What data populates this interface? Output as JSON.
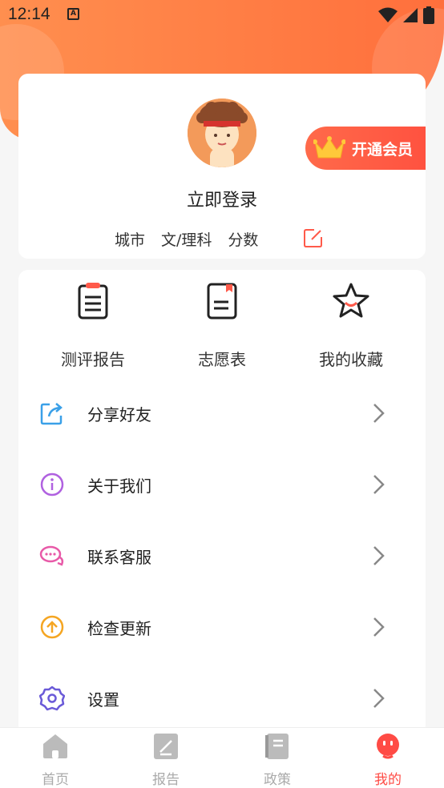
{
  "status_bar": {
    "time": "12:14",
    "app_icon_letter": "A"
  },
  "profile": {
    "login_label": "立即登录",
    "meta": [
      "城市",
      "文/理科",
      "分数"
    ],
    "vip_label": "开通会员"
  },
  "shortcuts": [
    {
      "label": "测评报告",
      "icon": "report-icon"
    },
    {
      "label": "志愿表",
      "icon": "form-icon"
    },
    {
      "label": "我的收藏",
      "icon": "star-icon"
    }
  ],
  "menu": [
    {
      "label": "分享好友",
      "icon": "share-icon"
    },
    {
      "label": "关于我们",
      "icon": "info-icon"
    },
    {
      "label": "联系客服",
      "icon": "chat-icon"
    },
    {
      "label": "检查更新",
      "icon": "update-icon"
    },
    {
      "label": "设置",
      "icon": "gear-icon"
    }
  ],
  "tabbar": [
    {
      "label": "首页",
      "icon": "home-icon",
      "active": false
    },
    {
      "label": "报告",
      "icon": "report-tab-icon",
      "active": false
    },
    {
      "label": "政策",
      "icon": "policy-icon",
      "active": false
    },
    {
      "label": "我的",
      "icon": "profile-icon",
      "active": true
    }
  ],
  "colors": {
    "accent": "#ff4b45",
    "hero": "#ff7a43"
  }
}
